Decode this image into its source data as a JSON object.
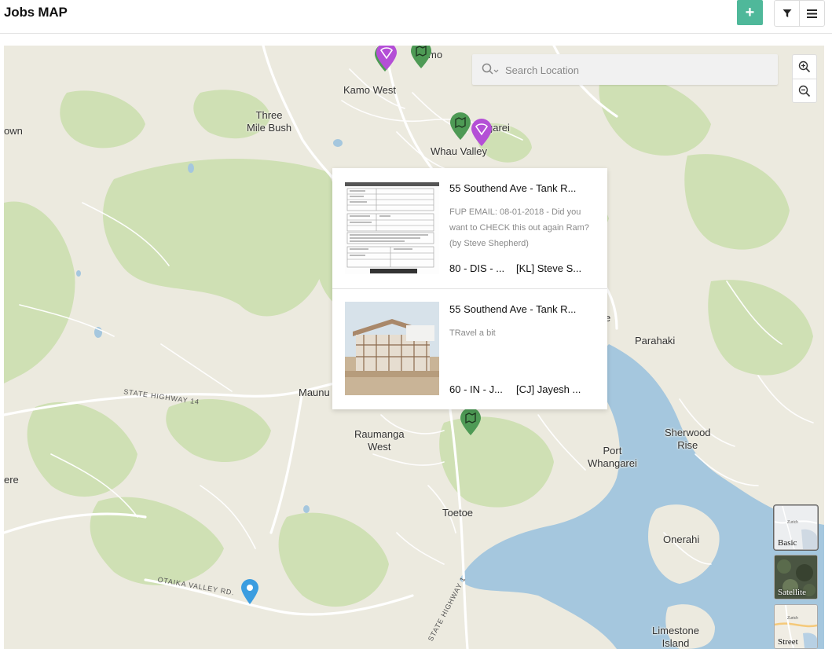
{
  "page": {
    "title": "Jobs MAP"
  },
  "toolbar": {
    "add_label": "+"
  },
  "map": {
    "search_placeholder": "Search Location",
    "labels": [
      {
        "text": "Kamo West"
      },
      {
        "text": "Three\nMile Bush"
      },
      {
        "text": "own"
      },
      {
        "text": "garei"
      },
      {
        "text": "Whau Valley"
      },
      {
        "text": "mo"
      },
      {
        "text": "e"
      },
      {
        "text": "Parahaki"
      },
      {
        "text": "Maunu"
      },
      {
        "text": "Raumanga\nWest"
      },
      {
        "text": "Sherwood\nRise"
      },
      {
        "text": "Port\nWhangarei"
      },
      {
        "text": "ere"
      },
      {
        "text": "Toetoe"
      },
      {
        "text": "Onerahi"
      },
      {
        "text": "Limestone\nIsland"
      }
    ],
    "road_labels": [
      "STATE HIGHWAY 14",
      "OTAIKA VALLEY RD.",
      "STATE HIGHWAY 1"
    ],
    "layers": [
      {
        "name": "Basic",
        "active": true
      },
      {
        "name": "Satellite",
        "active": false
      },
      {
        "name": "Street",
        "active": false
      }
    ],
    "layer_thumb_text": "Zurich"
  },
  "jobs": [
    {
      "title": "55 Southend Ave - Tank R...",
      "description": "FUP EMAIL: 08-01-2018 - Did you want to CHECK this out again Ram? (by Steve Shepherd)",
      "status": "80 - DIS - ...",
      "assignee": "[KL] Steve S..."
    },
    {
      "title": "55 Southend Ave - Tank R...",
      "description": "TRavel a bit",
      "status": "60 - IN - J...",
      "assignee": "[CJ] Jayesh ..."
    }
  ],
  "colors": {
    "accent": "#4fb89a",
    "pin_green": "#4e9a55",
    "pin_purple": "#b44fd6",
    "pin_blue": "#3b9de0",
    "water": "#a5c7de",
    "land": "#eceadf",
    "park": "#cfe0b4"
  }
}
